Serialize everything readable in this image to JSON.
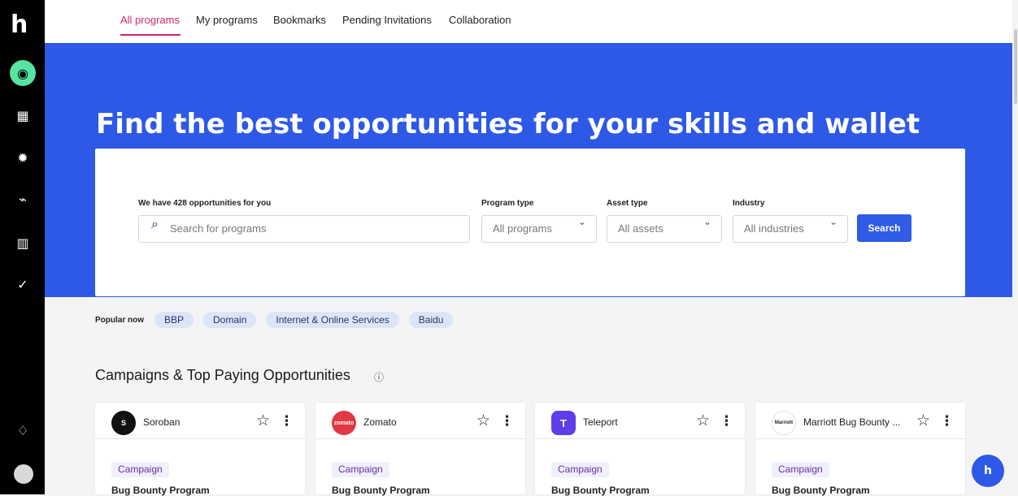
{
  "brand": {
    "logo": "h",
    "accent": "#2d59e6",
    "nav_accent": "#d6246e",
    "mint": "#58e3a0"
  },
  "nav": {
    "tabs": [
      "All programs",
      "My programs",
      "Bookmarks",
      "Pending Invitations",
      "Collaboration"
    ]
  },
  "sidebar": {
    "icons": [
      "target-icon",
      "dashboard-icon",
      "bug-icon",
      "reports-icon",
      "analytics-icon",
      "clipboard-check-icon",
      "bell-icon"
    ]
  },
  "hero": {
    "title": "Find the best opportunities for your skills and wallet"
  },
  "search": {
    "count_label": "We have 428 opportunities for you",
    "placeholder": "Search for programs",
    "program_type_label": "Program type",
    "program_type_value": "All programs",
    "asset_type_label": "Asset type",
    "asset_type_value": "All assets",
    "industry_label": "Industry",
    "industry_value": "All industries",
    "button": "Search"
  },
  "popular": {
    "label": "Popular now",
    "tags": [
      "BBP",
      "Domain",
      "Internet & Online Services",
      "Baidu"
    ]
  },
  "section": {
    "title": "Campaigns & Top Paying Opportunities",
    "info_icon": "ⓘ"
  },
  "cards": [
    {
      "name": "Soroban",
      "logo_text": "S",
      "logo_color": "#111111",
      "badge": "Campaign",
      "program_type": "Bug Bounty Program"
    },
    {
      "name": "Zomato",
      "logo_text": "zomato",
      "logo_color": "#e23744",
      "badge": "Campaign",
      "program_type": "Bug Bounty Program"
    },
    {
      "name": "Teleport",
      "logo_text": "T",
      "logo_color": "#5d3ee8",
      "badge": "Campaign",
      "program_type": "Bug Bounty Program"
    },
    {
      "name": "Marriott Bug Bounty ...",
      "logo_text": "Marriott",
      "logo_color": "#ffffff",
      "badge": "Campaign",
      "program_type": "Bug Bounty Program"
    }
  ],
  "fab": {
    "label": "h"
  }
}
